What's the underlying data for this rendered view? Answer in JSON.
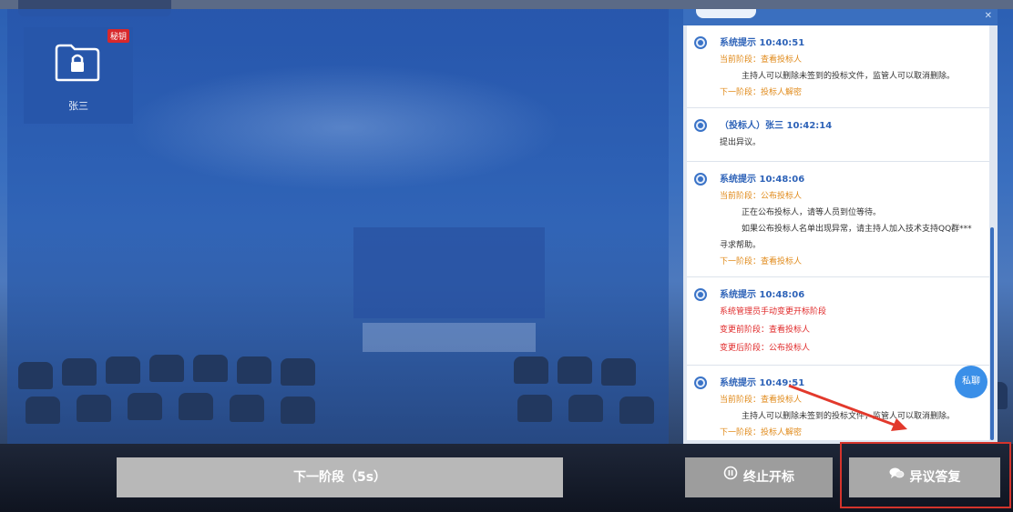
{
  "bidder_tile": {
    "badge": "秘钥",
    "name": "张三"
  },
  "chat": {
    "messages": [
      {
        "title": "系统提示 10:40:51",
        "lines": [
          {
            "text": "当前阶段：查看投标人",
            "color": "orange"
          },
          {
            "text": "主持人可以删除未签到的投标文件，监管人可以取消删除。",
            "color": "gray"
          },
          {
            "text": "下一阶段：投标人解密",
            "color": "orange"
          }
        ]
      },
      {
        "title": "（投标人）张三 10:42:14",
        "lines": [
          {
            "text": "提出异议。",
            "color": "gray"
          }
        ]
      },
      {
        "title": "系统提示 10:48:06",
        "lines": [
          {
            "text": "当前阶段：公布投标人",
            "color": "orange"
          },
          {
            "text": "正在公布投标人，请等人员到位等待。",
            "color": "gray"
          },
          {
            "text": "如果公布投标人名单出现异常，请主持人加入技术支持QQ群***",
            "color": "gray"
          },
          {
            "text": "寻求帮助。",
            "color": "gray"
          },
          {
            "text": "下一阶段：查看投标人",
            "color": "orange"
          }
        ]
      },
      {
        "title": "系统提示 10:48:06",
        "lines": [
          {
            "text": "系统管理员手动变更开标阶段",
            "color": "red"
          },
          {
            "text": "变更前阶段：查看投标人",
            "color": "red"
          },
          {
            "text": "变更后阶段：公布投标人",
            "color": "red"
          }
        ]
      },
      {
        "title": "系统提示 10:49:51",
        "lines": [
          {
            "text": "当前阶段：查看投标人",
            "color": "orange"
          },
          {
            "text": "主持人可以删除未签到的投标文件，监管人可以取消删除。",
            "color": "gray"
          },
          {
            "text": "下一阶段：投标人解密",
            "color": "orange"
          }
        ]
      }
    ]
  },
  "float_button": "私聊",
  "buttons": {
    "next_stage": "下一阶段（5s）",
    "stop": "终止开标",
    "reply": "异议答复"
  },
  "icons": {
    "stop": "pause-circle-icon",
    "reply": "chat-bubbles-icon",
    "lock": "lock-folder-icon"
  },
  "colors": {
    "orange": "#e08a1a",
    "red": "#e02a2a",
    "gray": "#333333",
    "accent": "#3a6fbf"
  }
}
